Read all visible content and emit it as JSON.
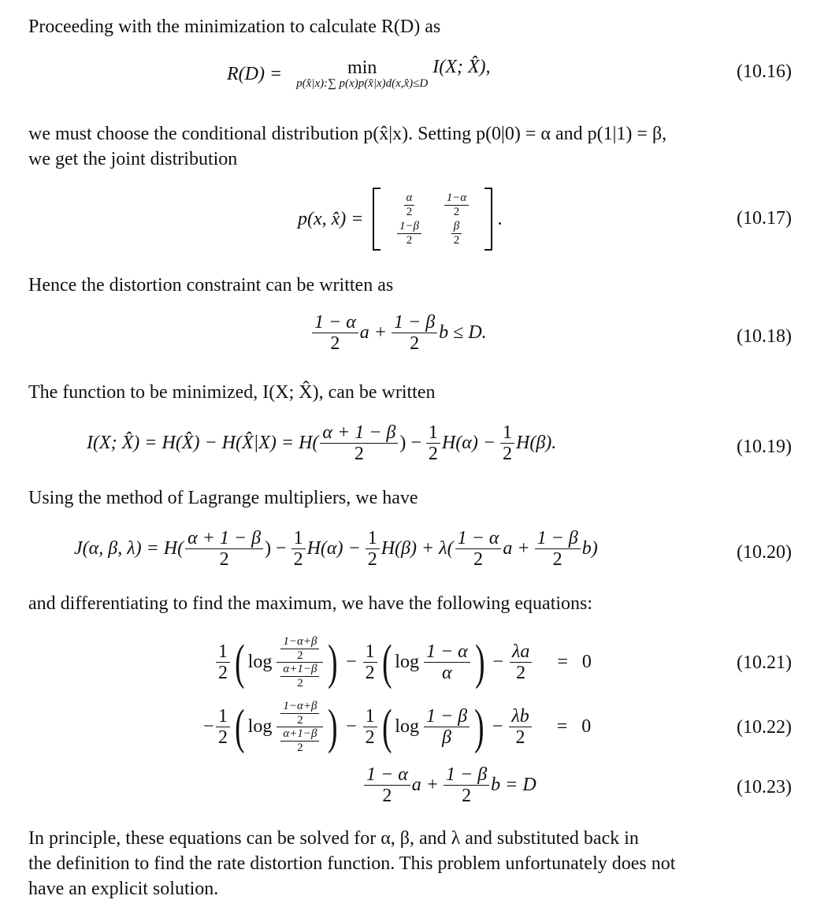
{
  "paragraphs": {
    "p1": "Proceeding with the minimization to calculate R(D) as",
    "p2_line1": "we must choose the conditional distribution p(x̂|x). Setting p(0|0) = α and p(1|1) = β,",
    "p2_line2": "we get the joint distribution",
    "p3": "Hence the distortion constraint can be written as",
    "p4": "The function to be minimized, I(X; X̂), can be written",
    "p5": "Using the method of Lagrange multipliers, we have",
    "p6": "and differentiating to find the maximum, we have the following equations:",
    "p7_line1": "In principle, these equations can be solved for α, β, and λ and substituted back in",
    "p7_line2": "the definition to find the rate distortion function. This problem unfortunately does not",
    "p7_line3": "have an explicit solution."
  },
  "equations": {
    "eq16": {
      "number": "(10.16)",
      "lhs": "R(D) =",
      "operator": "min",
      "subscript": "p(x̂|x):∑ p(x)p(x̂|x)d(x,x̂)≤D",
      "rhs": "I(X; X̂),"
    },
    "eq17": {
      "number": "(10.17)",
      "lhs": "p(x, x̂) =",
      "matrix": [
        [
          {
            "num": "α",
            "den": "2"
          },
          {
            "num": "1−α",
            "den": "2"
          }
        ],
        [
          {
            "num": "1−β",
            "den": "2"
          },
          {
            "num": "β",
            "den": "2"
          }
        ]
      ],
      "trailing": "."
    },
    "eq18": {
      "number": "(10.18)",
      "t1_num": "1 − α",
      "t1_den": "2",
      "t1_var": "a +",
      "t2_num": "1 − β",
      "t2_den": "2",
      "t2_var": "b ≤ D."
    },
    "eq19": {
      "number": "(10.19)",
      "lhs": "I(X; X̂) = H(X̂) − H(X̂|X) = H(",
      "f1_num": "α + 1 − β",
      "f1_den": "2",
      "mid1": ") −",
      "half_num": "1",
      "half_den": "2",
      "mid2": "H(α) −",
      "end": "H(β)."
    },
    "eq20": {
      "number": "(10.20)",
      "lhs": "J(α, β, λ) = H(",
      "f1_num": "α + 1 − β",
      "f1_den": "2",
      "mid1": ") −",
      "half_num": "1",
      "half_den": "2",
      "mid2": "H(α) −",
      "mid3": "H(β) + λ(",
      "f2_num": "1 − α",
      "f2_den": "2",
      "mid4": "a +",
      "f3_num": "1 − β",
      "f3_den": "2",
      "end": "b)"
    },
    "eq21": {
      "number": "(10.21)",
      "sign": "",
      "log": "log",
      "inner_num_num": "1−α+β",
      "inner_num_den": "2",
      "inner_den_num": "α+1−β",
      "inner_den_den": "2",
      "minus": "−",
      "f2_num": "1 − α",
      "f2_den": "α",
      "f3_num": "λa",
      "f3_den": "2",
      "eq": "=",
      "rhs": "0"
    },
    "eq22": {
      "number": "(10.22)",
      "sign": "−",
      "log": "log",
      "inner_num_num": "1−α+β",
      "inner_num_den": "2",
      "inner_den_num": "α+1−β",
      "inner_den_den": "2",
      "minus": "−",
      "f2_num": "1 − β",
      "f2_den": "β",
      "f3_num": "λb",
      "f3_den": "2",
      "eq": "=",
      "rhs": "0"
    },
    "eq23": {
      "number": "(10.23)",
      "t1_num": "1 − α",
      "t1_den": "2",
      "t1_var": "a +",
      "t2_num": "1 − β",
      "t2_den": "2",
      "t2_var": "b = D"
    },
    "half": {
      "num": "1",
      "den": "2"
    },
    "paren_open": "(",
    "paren_close": ")"
  }
}
